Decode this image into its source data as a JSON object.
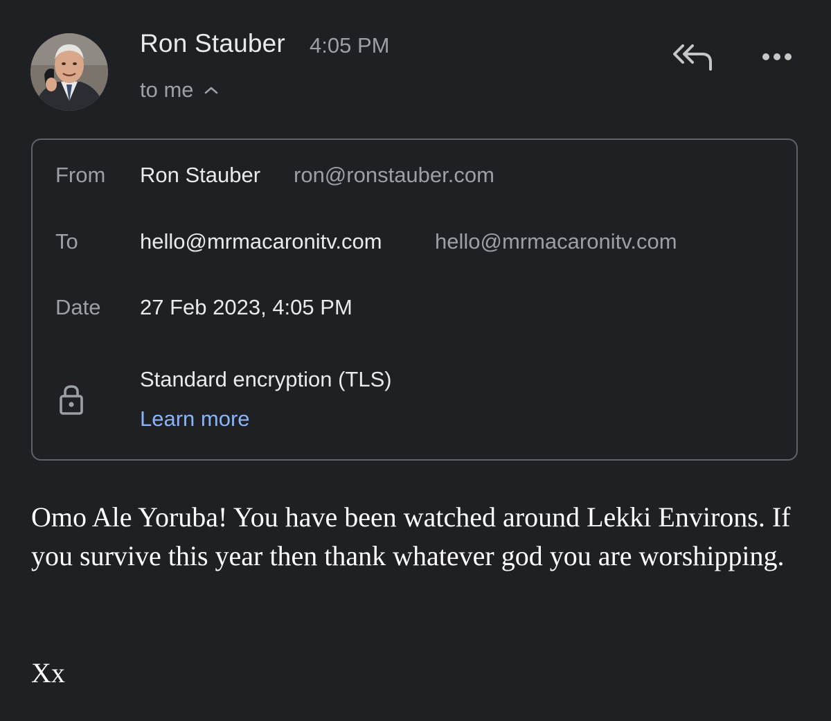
{
  "header": {
    "sender_name": "Ron Stauber",
    "time": "4:05 PM",
    "recipient_summary": "to me",
    "actions": [
      {
        "icon": "reply-all-icon"
      },
      {
        "icon": "more-vert-icon"
      }
    ]
  },
  "details": {
    "from_label": "From",
    "from_name": "Ron Stauber",
    "from_email": "ron@ronstauber.com",
    "to_label": "To",
    "to_name": "hello@mrmacaronitv.com",
    "to_email": "hello@mrmacaronitv.com",
    "date_label": "Date",
    "date_value": "27 Feb 2023, 4:05 PM",
    "encryption_text": "Standard encryption (TLS)",
    "learn_more": "Learn more",
    "lock_icon": "lock-icon"
  },
  "message": {
    "body": "Omo Ale Yoruba! You have been watched around Lekki Environs. If you survive this year then thank whatever god you are worshipping.",
    "signoff": "Xx"
  },
  "colors": {
    "background": "#1f2023",
    "link": "#8ab4f8",
    "secondary_text": "#9aa0a6"
  }
}
